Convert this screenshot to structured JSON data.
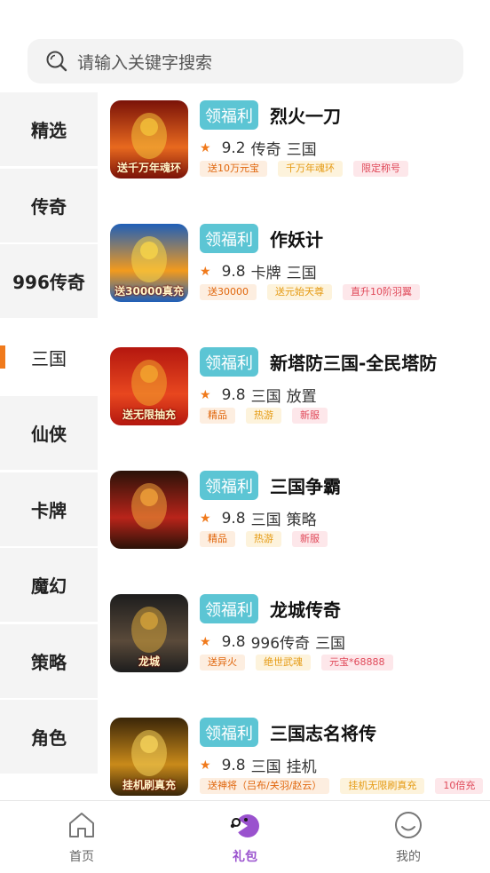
{
  "search": {
    "placeholder": "请输入关键字搜索",
    "icon": "search-icon"
  },
  "sidebar": {
    "active_index": 3,
    "items": [
      {
        "label": "精选"
      },
      {
        "label": "传奇"
      },
      {
        "label": "996传奇"
      },
      {
        "label": "三国"
      },
      {
        "label": "仙侠"
      },
      {
        "label": "卡牌"
      },
      {
        "label": "魔幻"
      },
      {
        "label": "策略"
      },
      {
        "label": "角色"
      }
    ]
  },
  "gift_button_label": "领福利",
  "games": [
    {
      "name": "烈火一刀",
      "rating": "9.2",
      "genres": [
        "传奇",
        "三国"
      ],
      "tags": [
        "送10万元宝",
        "千万年魂环",
        "限定称号"
      ],
      "icon_caption": "送千万年魂环"
    },
    {
      "name": "作妖计",
      "rating": "9.8",
      "genres": [
        "卡牌",
        "三国"
      ],
      "tags": [
        "送30000",
        "送元始天尊",
        "直升10阶羽翼"
      ],
      "icon_caption": "送30000真充"
    },
    {
      "name": "新塔防三国-全民塔防",
      "rating": "9.8",
      "genres": [
        "三国",
        "放置"
      ],
      "tags": [
        "精品",
        "热游",
        "新服"
      ],
      "icon_caption": "送无限抽充"
    },
    {
      "name": "三国争霸",
      "rating": "9.8",
      "genres": [
        "三国",
        "策略"
      ],
      "tags": [
        "精品",
        "热游",
        "新服"
      ],
      "icon_caption": ""
    },
    {
      "name": "龙城传奇",
      "rating": "9.8",
      "genres": [
        "996传奇",
        "三国"
      ],
      "tags": [
        "送异火",
        "绝世武魂",
        "元宝*68888"
      ],
      "icon_caption": "龙城"
    },
    {
      "name": "三国志名将传",
      "rating": "9.8",
      "genres": [
        "三国",
        "挂机"
      ],
      "tags": [
        "送神将（吕布/关羽/赵云）",
        "挂机无限刷真充",
        "10倍充"
      ],
      "icon_caption": "挂机刷真充"
    }
  ],
  "tabbar": {
    "items": [
      {
        "label": "首页",
        "icon": "home-icon"
      },
      {
        "label": "礼包",
        "icon": "gift-pacman-icon"
      },
      {
        "label": "我的",
        "icon": "profile-smile-icon"
      }
    ],
    "active_index": 1
  },
  "colors": {
    "accent": "#f07a1c",
    "gift_button": "#5cc5d4",
    "active_tab": "#9a52ce"
  }
}
